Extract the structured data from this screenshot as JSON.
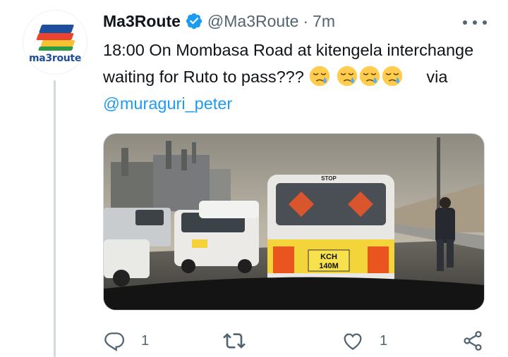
{
  "tweet": {
    "display_name": "Ma3Route",
    "handle": "@Ma3Route",
    "separator": "·",
    "time": "7m",
    "avatar_text": "ma3route",
    "text_main": "18:00 On Mombasa Road at kitengela interchange waiting for Ruto to pass???",
    "via_label": "via",
    "via_link": "@muraguri_peter",
    "media_plate": "KCH 140M",
    "media_plate_line1": "KCH",
    "media_plate_line2": "140M",
    "media_stop_sign": "STOP",
    "emoji_name": "sleepy-face-emoji",
    "emoji_count": 4
  },
  "actions": {
    "reply_count": "1",
    "retweet_count": "",
    "like_count": "1"
  },
  "colors": {
    "accent": "#1d9bf0",
    "text": "#0f1419",
    "secondary": "#536471",
    "thread_line": "#cfd9de"
  },
  "icons": [
    "verified-badge-icon",
    "more-icon",
    "reply-icon",
    "retweet-icon",
    "like-icon",
    "share-icon"
  ]
}
